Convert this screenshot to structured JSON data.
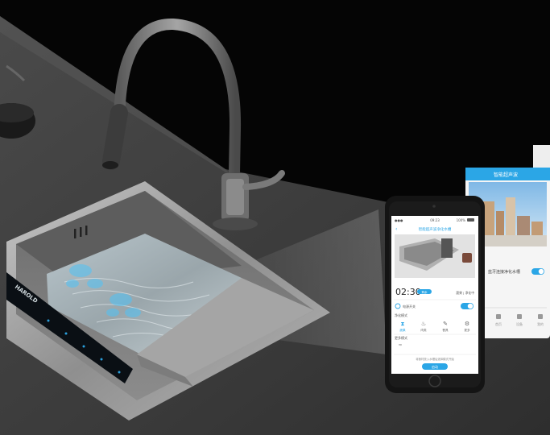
{
  "brand": {
    "logo_text": "HAROLD"
  },
  "phone": {
    "status_time": "09:23",
    "status_battery": "100%",
    "app_title": "智能超声波净化水槽",
    "timer": "02:30",
    "timer_badge": "剩余",
    "mode_text": "蔬果 | 净化中",
    "switch_label": "电源开关",
    "section_mode": "净化模式",
    "tabs": [
      {
        "label": "蔬果",
        "icon": "hourglass-icon"
      },
      {
        "label": "肉类",
        "icon": "meat-icon"
      },
      {
        "label": "餐具",
        "icon": "utensils-icon"
      },
      {
        "label": "更多",
        "icon": "settings-icon"
      }
    ],
    "section_more": "更多模式",
    "hint": "将食材放入水槽后选择模式开始",
    "start_button": "启动"
  },
  "tablet": {
    "title": "智能超声波",
    "toggle_label": "蓝牙连接净化水槽",
    "nav": [
      "首页",
      "设备",
      "我的"
    ]
  },
  "colors": {
    "background": "#000000",
    "counter": "#3d3d3d",
    "steel": "#9a9a9a",
    "accent": "#1ea7e8"
  }
}
